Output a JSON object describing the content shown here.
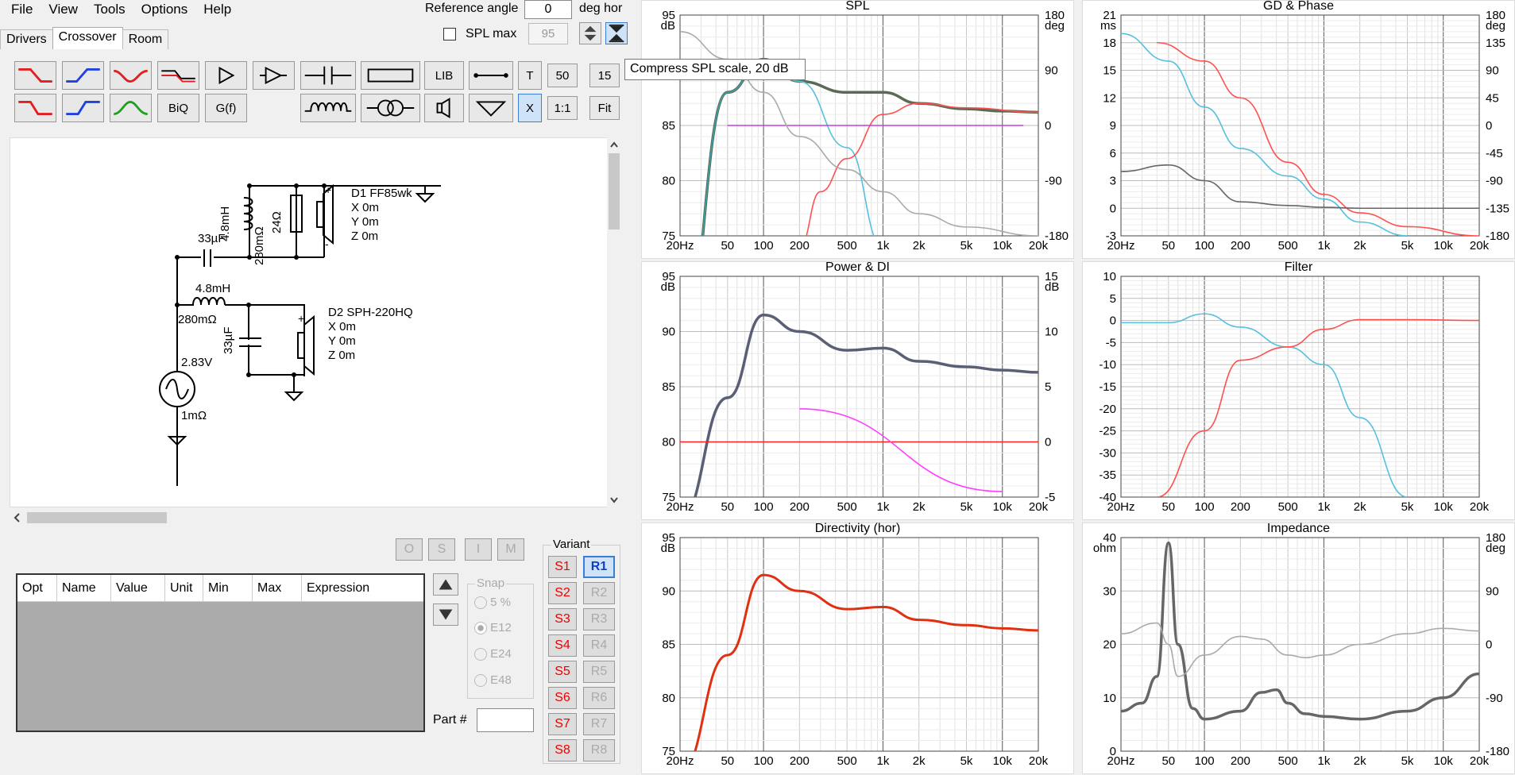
{
  "menu": [
    "File",
    "View",
    "Tools",
    "Options",
    "Help"
  ],
  "ref_angle": {
    "label": "Reference angle",
    "value": "0",
    "unit": "deg hor"
  },
  "spl_max": {
    "label": "SPL max",
    "value": "95"
  },
  "tabs": [
    "Drivers",
    "Crossover",
    "Room"
  ],
  "toolbar": {
    "lib": "LIB",
    "t": "T",
    "v50": "50",
    "v15": "15",
    "biq": "BiQ",
    "gf": "G(f)",
    "x": "X",
    "ratio": "1:1",
    "fit": "Fit"
  },
  "tooltip": "Compress SPL scale, 20 dB",
  "schematic": {
    "d1": [
      "D1 FF85wk",
      "X 0m",
      "Y 0m",
      "Z 0m"
    ],
    "d2": [
      "D2 SPH-220HQ",
      "X 0m",
      "Y 0m",
      "Z 0m"
    ],
    "labels": {
      "c1": "33µF",
      "l1": "4.8mH",
      "r1": "280mΩ",
      "r2": "24Ω",
      "l2": "4.8mH",
      "r3": "280mΩ",
      "c2": "33µF",
      "v": "2.83V",
      "rs": "1mΩ"
    }
  },
  "opt_buttons": [
    "O",
    "S",
    "I",
    "M"
  ],
  "table": {
    "columns": [
      "Opt",
      "Name",
      "Value",
      "Unit",
      "Min",
      "Max",
      "Expression"
    ]
  },
  "snap": {
    "label": "Snap",
    "options": [
      "5 %",
      "E12",
      "E24",
      "E48"
    ],
    "selected": "E12"
  },
  "variant": {
    "label": "Variant",
    "s": [
      "S1",
      "S2",
      "S3",
      "S4",
      "S5",
      "S6",
      "S7",
      "S8"
    ],
    "r": [
      "R1",
      "R2",
      "R3",
      "R4",
      "R5",
      "R6",
      "R7",
      "R8"
    ]
  },
  "part": {
    "label": "Part #"
  },
  "freq_ticks": [
    "20Hz",
    "50",
    "100",
    "200",
    "500",
    "1k",
    "2k",
    "5k",
    "10k",
    "20k"
  ],
  "charts": [
    {
      "title": "SPL",
      "lunit": "dB",
      "runit": "deg",
      "lticks": [
        "95",
        "90",
        "85",
        "80",
        "75"
      ],
      "rticks": [
        "180",
        "90",
        "0",
        "-90",
        "-180"
      ]
    },
    {
      "title": "GD & Phase",
      "lunit": "ms",
      "runit": "deg",
      "lticks": [
        "21",
        "18",
        "15",
        "12",
        "9",
        "6",
        "3",
        "0",
        "-3"
      ],
      "rticks": [
        "180",
        "135",
        "90",
        "45",
        "0",
        "-45",
        "-90",
        "-135",
        "-180"
      ]
    },
    {
      "title": "Power & DI",
      "lunit": "dB",
      "runit": "dB",
      "lticks": [
        "95",
        "90",
        "85",
        "80",
        "75"
      ],
      "rticks": [
        "15",
        "10",
        "5",
        "0",
        "-5"
      ]
    },
    {
      "title": "Filter",
      "lunit": "",
      "runit": "",
      "lticks": [
        "10",
        "5",
        "0",
        "-5",
        "-10",
        "-15",
        "-20",
        "-25",
        "-30",
        "-35",
        "-40"
      ],
      "rticks": []
    },
    {
      "title": "Directivity (hor)",
      "lunit": "dB",
      "runit": "",
      "lticks": [
        "95",
        "90",
        "85",
        "80",
        "75"
      ],
      "rticks": []
    },
    {
      "title": "Impedance",
      "lunit": "ohm",
      "runit": "deg",
      "lticks": [
        "40",
        "30",
        "20",
        "10",
        "0"
      ],
      "rticks": [
        "180",
        "90",
        "0",
        "-90",
        "-180"
      ]
    }
  ],
  "chart_data": [
    {
      "type": "line",
      "title": "SPL",
      "xlabel": "",
      "ylabel": "dB",
      "ylim": [
        75,
        95
      ],
      "y2lim": [
        -180,
        180
      ],
      "series": [
        {
          "color": "#5a6a55",
          "x": [
            20,
            50,
            100,
            200,
            500,
            1000,
            2000,
            5000,
            10000,
            20000
          ],
          "y": [
            64,
            88,
            91,
            89,
            88,
            88,
            87,
            86.5,
            86.3,
            86.2
          ]
        },
        {
          "color": "#3aa0a8",
          "x": [
            20,
            50,
            100
          ],
          "y": [
            64,
            88,
            91
          ]
        },
        {
          "color": "#55c0e0",
          "x": [
            100,
            200,
            500,
            1000
          ],
          "y": [
            91,
            89,
            83,
            74
          ]
        },
        {
          "color": "#ff5050",
          "x": [
            200,
            300,
            500,
            1000,
            2000,
            5000,
            20000
          ],
          "y": [
            74,
            79,
            82,
            86,
            87,
            86.6,
            86.2
          ]
        },
        {
          "color": "#c040e0",
          "x": [
            50,
            15000
          ],
          "y": [
            85,
            85
          ]
        },
        {
          "color": "#aaaaaa",
          "x": [
            20,
            50,
            100,
            200,
            500,
            1000,
            2000,
            5000,
            20000
          ],
          "y": [
            93.5,
            91,
            88,
            84,
            81,
            79,
            77,
            75.8,
            75
          ]
        }
      ]
    },
    {
      "type": "line",
      "title": "GD & Phase",
      "ylabel": "ms",
      "ylim": [
        -3,
        21
      ],
      "y2lim": [
        -180,
        180
      ],
      "series": [
        {
          "color": "#55c0e0",
          "x": [
            20,
            50,
            100,
            200,
            500,
            1000,
            2000,
            5000
          ],
          "y": [
            19,
            16,
            11,
            6.5,
            3.5,
            1,
            -1.5,
            -3
          ]
        },
        {
          "color": "#ff5050",
          "x": [
            40,
            100,
            200,
            500,
            1000,
            2000,
            5000,
            20000
          ],
          "y": [
            18,
            16,
            12,
            5,
            1.5,
            -0.5,
            -2,
            -3
          ]
        },
        {
          "color": "#666666",
          "x": [
            20,
            50,
            100,
            200,
            500,
            1000,
            2000,
            5000,
            20000
          ],
          "y": [
            4,
            4.7,
            3,
            0.7,
            0.3,
            0.1,
            0,
            0,
            0
          ]
        }
      ]
    },
    {
      "type": "line",
      "title": "Power & DI",
      "ylabel": "dB",
      "ylim": [
        75,
        95
      ],
      "y2lim": [
        -5,
        15
      ],
      "series": [
        {
          "color": "#5a5f75",
          "x": [
            20,
            50,
            100,
            200,
            500,
            1000,
            2000,
            5000,
            10000,
            20000
          ],
          "y": [
            73,
            84,
            91.5,
            90,
            88.3,
            88.5,
            87.3,
            86.8,
            86.5,
            86.3
          ]
        },
        {
          "color": "#ff2020",
          "x": [
            20,
            20000
          ],
          "y": [
            80,
            80
          ]
        },
        {
          "color": "#ff40ff",
          "x": [
            200,
            10000
          ],
          "y": [
            83,
            75.5
          ]
        }
      ]
    },
    {
      "type": "line",
      "title": "Filter",
      "ylabel": "",
      "ylim": [
        -40,
        10
      ],
      "series": [
        {
          "color": "#55c0e0",
          "x": [
            20,
            50,
            100,
            200,
            500,
            1000,
            2000,
            5000
          ],
          "y": [
            -0.5,
            -0.5,
            1.5,
            -1.5,
            -6,
            -10,
            -22,
            -40
          ]
        },
        {
          "color": "#ff5050",
          "x": [
            40,
            100,
            200,
            500,
            1000,
            2000,
            5000,
            20000
          ],
          "y": [
            -40,
            -25,
            -9,
            -6,
            -2,
            0.2,
            0.2,
            0
          ]
        }
      ]
    },
    {
      "type": "line",
      "title": "Directivity (hor)",
      "ylabel": "dB",
      "ylim": [
        75,
        95
      ],
      "series": [
        {
          "color": "#e03010",
          "x": [
            20,
            50,
            100,
            200,
            500,
            1000,
            2000,
            5000,
            10000,
            20000
          ],
          "y": [
            73,
            84,
            91.5,
            90,
            88.3,
            88.5,
            87.3,
            86.8,
            86.5,
            86.3
          ]
        }
      ]
    },
    {
      "type": "line",
      "title": "Impedance",
      "ylabel": "ohm",
      "ylim": [
        0,
        40
      ],
      "y2lim": [
        -180,
        180
      ],
      "series": [
        {
          "color": "#666666",
          "x": [
            20,
            30,
            40,
            50,
            60,
            80,
            100,
            200,
            300,
            400,
            500,
            700,
            1000,
            2000,
            5000,
            10000,
            20000
          ],
          "y": [
            7.5,
            9,
            14,
            39,
            20,
            8,
            6,
            7.5,
            11,
            11.5,
            9,
            7,
            6.5,
            6,
            7.5,
            10,
            14.5
          ]
        },
        {
          "color": "#aaaaaa",
          "x": [
            20,
            40,
            50,
            60,
            100,
            200,
            300,
            500,
            700,
            1000,
            2000,
            5000,
            10000,
            20000
          ],
          "y": [
            22,
            24,
            20,
            14,
            18,
            21.5,
            21,
            18,
            17.5,
            18,
            20,
            22,
            23,
            22.5
          ]
        }
      ]
    }
  ]
}
